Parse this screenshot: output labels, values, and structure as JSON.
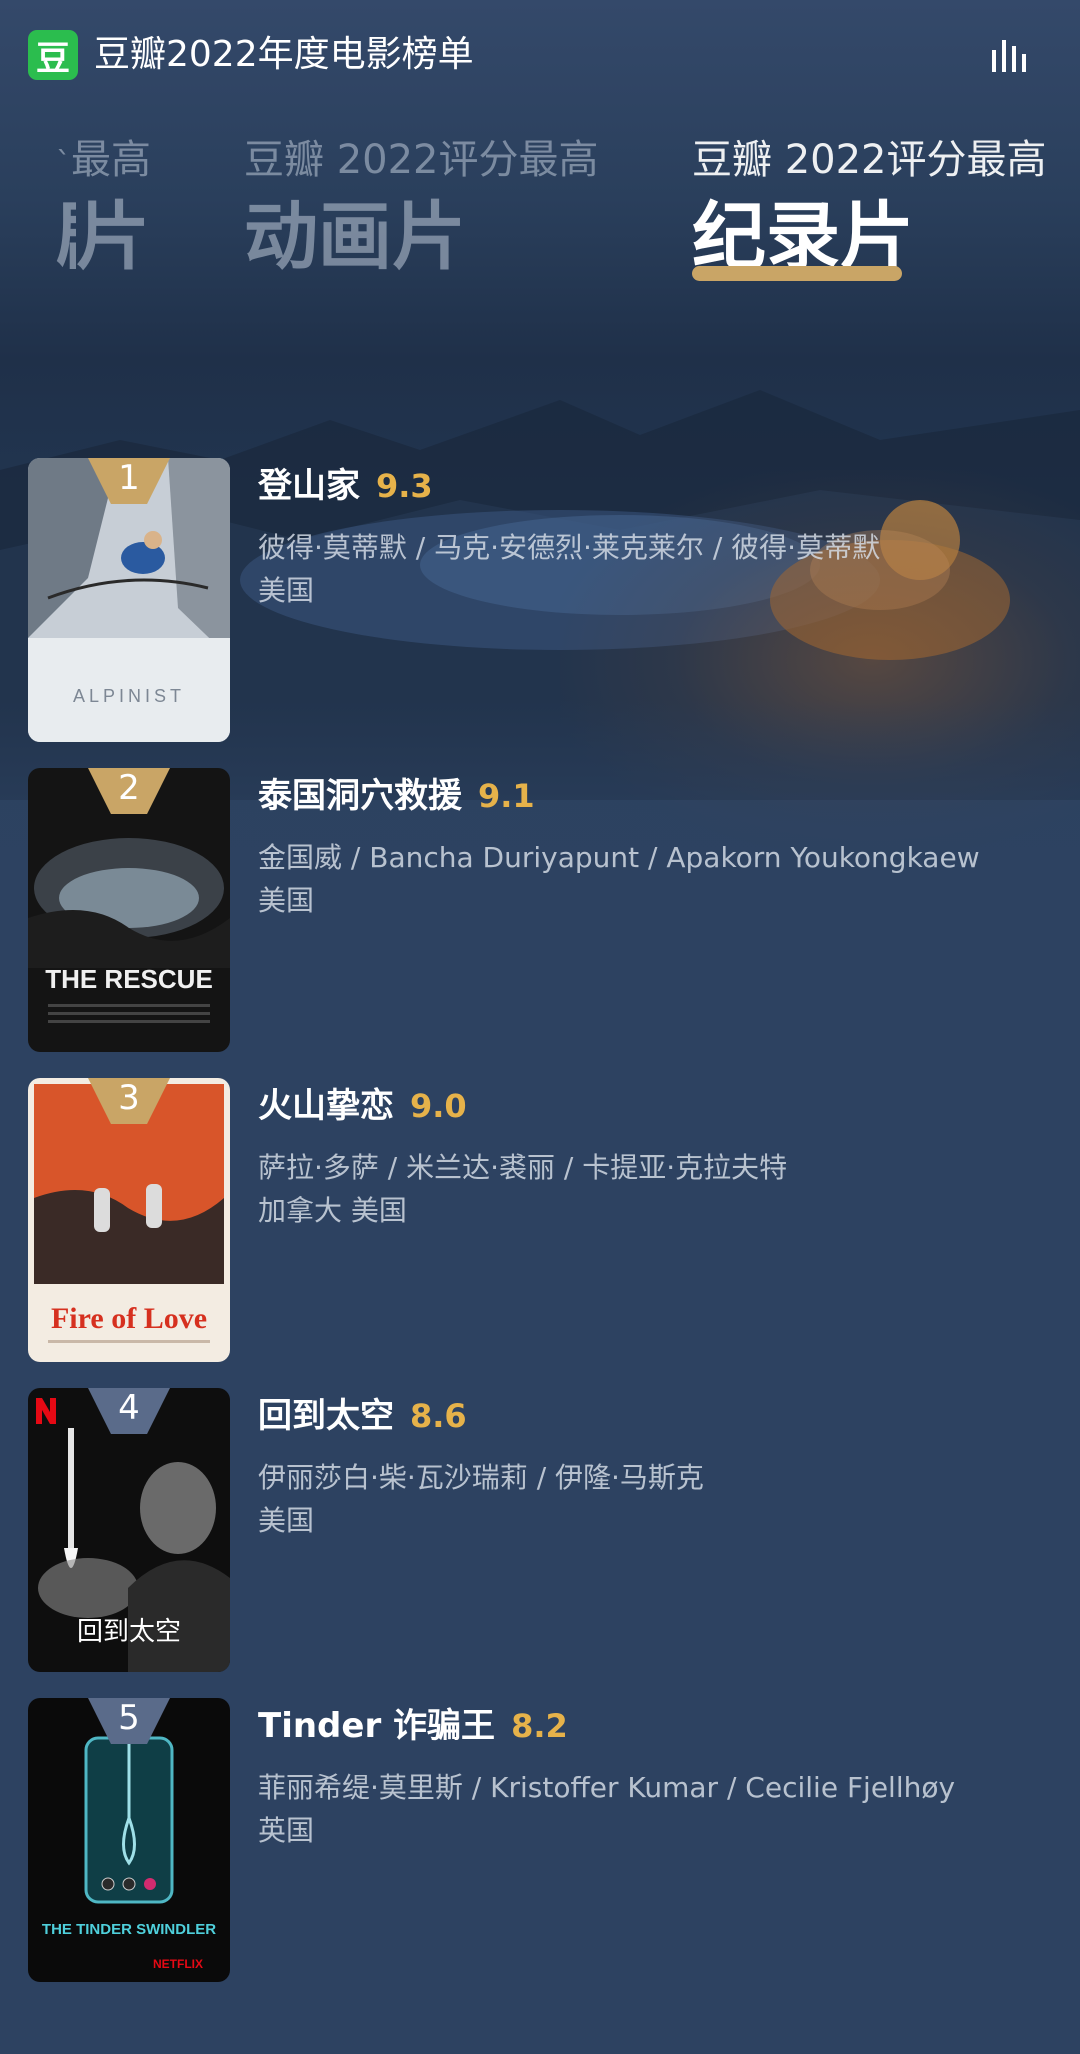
{
  "header": {
    "logo_char": "豆",
    "title": "豆瓣2022年度电影榜单",
    "chart_icon": "bar-chart-icon"
  },
  "tabs": [
    {
      "subtitle": "最高",
      "title": "片",
      "active": false
    },
    {
      "subtitle": "豆瓣 2022评分最高",
      "title": "动画片",
      "active": false
    },
    {
      "subtitle": "豆瓣 2022评分最高",
      "title": "纪录片",
      "active": true
    }
  ],
  "colors": {
    "background": "#2d4261",
    "score": "#e6b24a",
    "accent_underline": "#c9a566",
    "logo": "#2bbd4e",
    "rank_badge_gold": "#c9a566",
    "rank_badge_slate": "#5a6b8a"
  },
  "movies": [
    {
      "rank": "1",
      "title": "登山家",
      "score": "9.3",
      "people": "彼得·莫蒂默 / 马克·安德烈·莱克莱尔 / 彼得·莫蒂默",
      "country": "美国",
      "poster_text": "ALPINIST"
    },
    {
      "rank": "2",
      "title": "泰国洞穴救援",
      "score": "9.1",
      "people": "金国威 / Bancha Duriyapunt / Apakorn Youkongkaew",
      "country": "美国",
      "poster_text": "THE RESCUE"
    },
    {
      "rank": "3",
      "title": "火山挚恋",
      "score": "9.0",
      "people": "萨拉·多萨 / 米兰达·裘丽 / 卡提亚·克拉夫特",
      "country": "加拿大 美国",
      "poster_text": "Fire of Love"
    },
    {
      "rank": "4",
      "title": "回到太空",
      "score": "8.6",
      "people": "伊丽莎白·柴·瓦沙瑞莉 / 伊隆·马斯克",
      "country": "美国",
      "poster_text": "回到太空"
    },
    {
      "rank": "5",
      "title": "Tinder 诈骗王",
      "score": "8.2",
      "people": "菲丽希缇·莫里斯 / Kristoffer Kumar / Cecilie Fjellhøy",
      "country": "英国",
      "poster_text": "THE TINDER SWINDLER"
    }
  ]
}
